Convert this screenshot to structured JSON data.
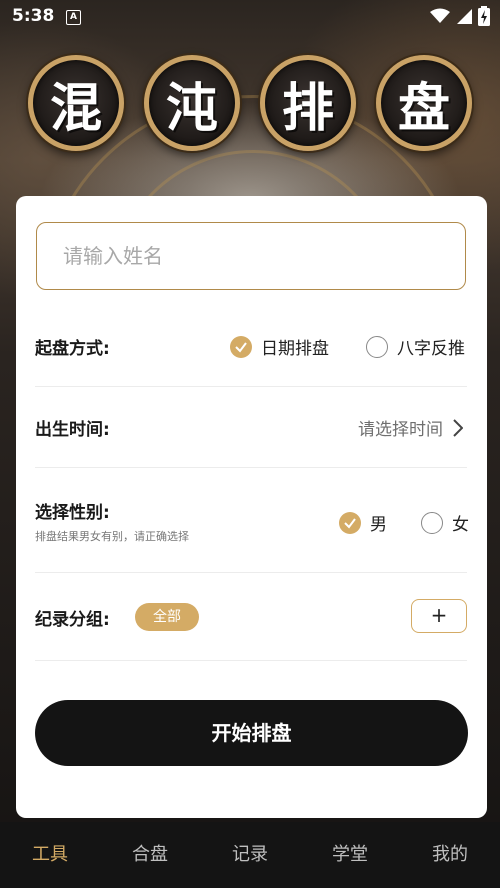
{
  "status_bar": {
    "time": "5:38",
    "notification_icon": "A",
    "icons": [
      "wifi-icon",
      "cell-signal-icon",
      "battery-charging-icon"
    ]
  },
  "title_chars": [
    "混",
    "沌",
    "排",
    "盘"
  ],
  "form": {
    "name_placeholder": "请输入姓名",
    "name_value": "",
    "method": {
      "label": "起盘方式:",
      "options": [
        {
          "label": "日期排盘",
          "checked": true
        },
        {
          "label": "八字反推",
          "checked": false
        }
      ]
    },
    "birth_time": {
      "label": "出生时间:",
      "placeholder": "请选择时间"
    },
    "gender": {
      "label": "选择性别:",
      "hint": "排盘结果男女有别，请正确选择",
      "options": [
        {
          "label": "男",
          "checked": true
        },
        {
          "label": "女",
          "checked": false
        }
      ]
    },
    "group": {
      "label": "纪录分组:",
      "tag": "全部",
      "add_label": "+"
    },
    "submit_label": "开始排盘"
  },
  "nav": {
    "items": [
      {
        "label": "工具",
        "active": true
      },
      {
        "label": "合盘",
        "active": false
      },
      {
        "label": "记录",
        "active": false
      },
      {
        "label": "学堂",
        "active": false
      },
      {
        "label": "我的",
        "active": false
      }
    ]
  },
  "colors": {
    "accent": "#d4ab65",
    "dark": "#141414",
    "card": "#ffffff"
  }
}
